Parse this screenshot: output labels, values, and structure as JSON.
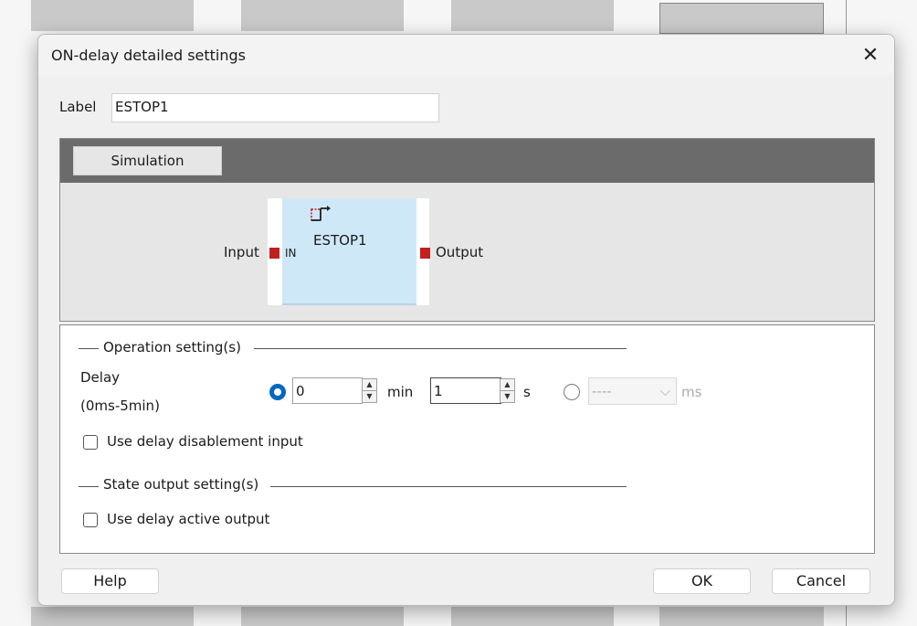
{
  "dialog": {
    "title": "ON-delay detailed settings",
    "close_symbol": "✕"
  },
  "label_field": {
    "label": "Label",
    "value": "ESTOP1"
  },
  "simulation": {
    "tab_label": "Simulation",
    "block_name": "ESTOP1",
    "input_label": "Input",
    "in_port_label": "IN",
    "output_label": "Output"
  },
  "operation": {
    "group_title": "Operation setting(s)",
    "delay_label": "Delay",
    "delay_range": "(0ms-5min)",
    "min_value": "0",
    "min_unit": "min",
    "sec_value": "1",
    "sec_unit": "s",
    "ms_value": "----",
    "ms_unit": "ms",
    "selected_mode": "min-s",
    "use_delay_disablement_input": {
      "label": "Use delay disablement input",
      "checked": false
    }
  },
  "state_output": {
    "group_title": "State output setting(s)",
    "use_delay_active_output": {
      "label": "Use delay active output",
      "checked": false
    }
  },
  "buttons": {
    "help": "Help",
    "ok": "OK",
    "cancel": "Cancel"
  },
  "colors": {
    "accent": "#0067c0",
    "port": "#c0201e",
    "block": "#cfe8f8",
    "sim_header": "#6b6b6b"
  }
}
